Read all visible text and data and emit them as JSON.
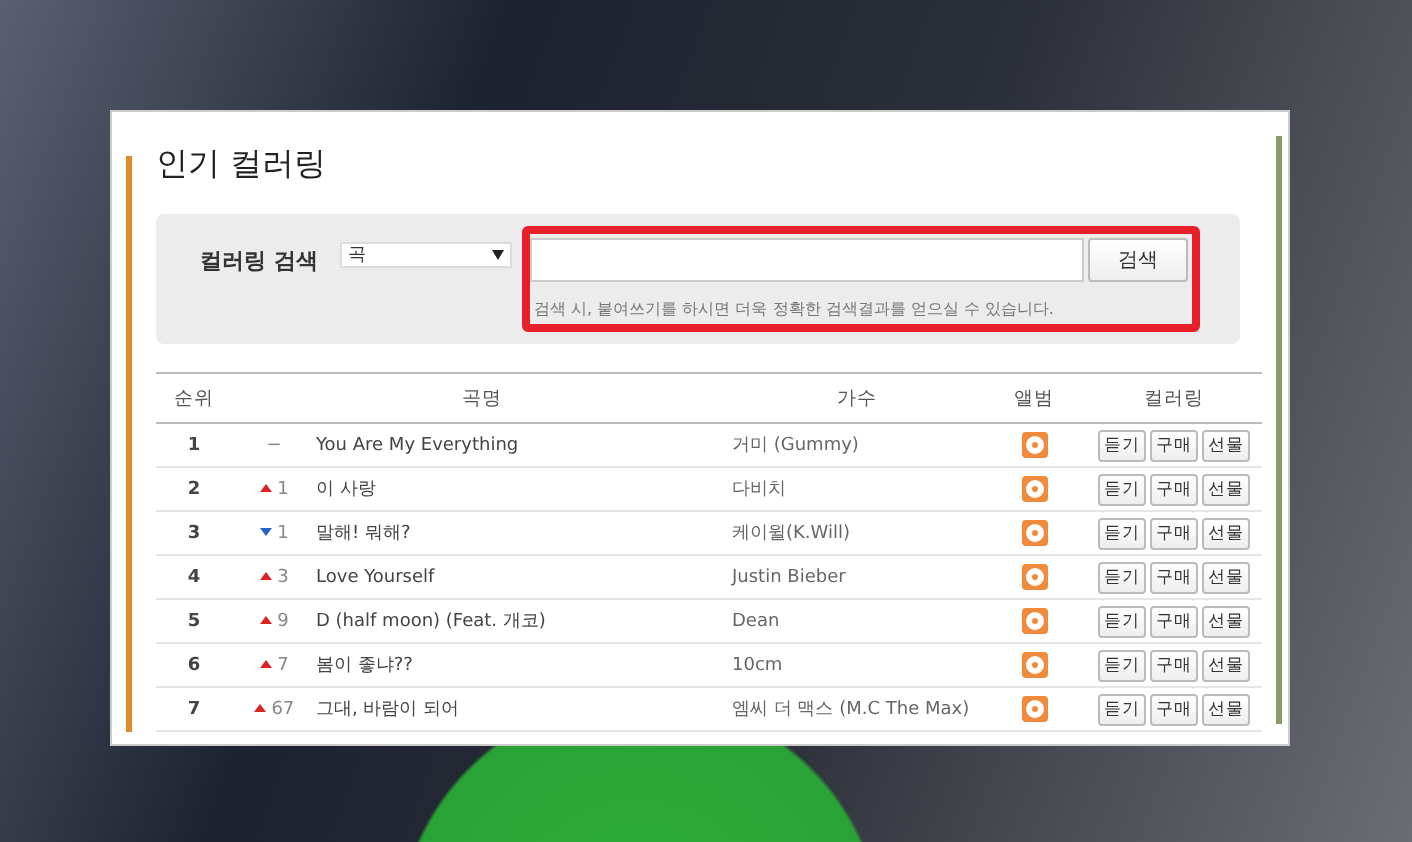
{
  "page": {
    "title": "인기 컬러링"
  },
  "search": {
    "label": "컬러링 검색",
    "category": "곡",
    "button": "검색",
    "hint": "검색 시, 붙여쓰기를 하시면 더욱 정확한 검색결과를 얻으실 수 있습니다."
  },
  "table": {
    "columns": [
      "순위",
      "곡명",
      "가수",
      "앨범",
      "컬러링"
    ],
    "rows": [
      {
        "rank": "1",
        "change": {
          "kind": "same",
          "text": "−"
        },
        "title": "You Are My Everything",
        "artist": "거미 (Gummy)",
        "actions": [
          "듣기",
          "구매",
          "선물"
        ]
      },
      {
        "rank": "2",
        "change": {
          "kind": "up",
          "text": "1"
        },
        "title": "이 사랑",
        "artist": "다비치",
        "actions": [
          "듣기",
          "구매",
          "선물"
        ]
      },
      {
        "rank": "3",
        "change": {
          "kind": "down",
          "text": "1"
        },
        "title": "말해! 뭐해?",
        "artist": "케이윌(K.Will)",
        "actions": [
          "듣기",
          "구매",
          "선물"
        ]
      },
      {
        "rank": "4",
        "change": {
          "kind": "up",
          "text": "3"
        },
        "title": "Love Yourself",
        "artist": "Justin Bieber",
        "actions": [
          "듣기",
          "구매",
          "선물"
        ]
      },
      {
        "rank": "5",
        "change": {
          "kind": "up",
          "text": "9"
        },
        "title": "D (half moon) (Feat. 개코)",
        "artist": "Dean",
        "actions": [
          "듣기",
          "구매",
          "선물"
        ]
      },
      {
        "rank": "6",
        "change": {
          "kind": "up",
          "text": "7"
        },
        "title": "봄이 좋냐??",
        "artist": "10cm",
        "actions": [
          "듣기",
          "구매",
          "선물"
        ]
      },
      {
        "rank": "7",
        "change": {
          "kind": "up",
          "text": "67"
        },
        "title": "그대, 바람이 되어",
        "artist": "엠씨 더 맥스 (M.C The Max)",
        "actions": [
          "듣기",
          "구매",
          "선물"
        ]
      }
    ]
  }
}
